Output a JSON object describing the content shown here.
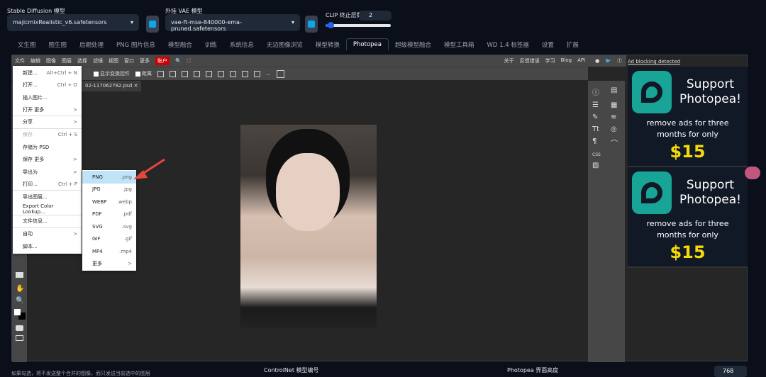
{
  "header": {
    "sd_label": "Stable Diffusion 模型",
    "sd_value": "majicmixRealistic_v6.safetensors",
    "vae_label": "外挂 VAE 模型",
    "vae_value": "vae-ft-mse-840000-ema-pruned.safetensors",
    "clip_label": "CLIP 终止层数",
    "clip_value": "2",
    "clip_fraction": 0.08
  },
  "tabs": [
    "文生图",
    "图生图",
    "后期处理",
    "PNG 图片信息",
    "模型融合",
    "训练",
    "系统信息",
    "无边图像浏览",
    "模型转换",
    "Photopea",
    "超级模型融合",
    "模型工具箱",
    "WD 1.4 标签器",
    "设置",
    "扩展"
  ],
  "photopea": {
    "menu": [
      "文件",
      "编辑",
      "图像",
      "图层",
      "选择",
      "滤镜",
      "视图",
      "窗口",
      "更多"
    ],
    "account": "账户",
    "right_links": [
      "关于",
      "反馈错误",
      "学习",
      "Blog",
      "API"
    ],
    "toolbar": {
      "show_transform": "显示变换控件",
      "distance": "距离",
      "more": "..."
    },
    "doc_tab": "02-117062782.psd",
    "file_menu": [
      {
        "label": "新建...",
        "key": "Alt+Ctrl + N"
      },
      {
        "label": "打开...",
        "key": "Ctrl + O"
      },
      {
        "label": "插入图片...",
        "key": ""
      },
      {
        "label": "打开 更多",
        "key": ">",
        "sep": true
      },
      {
        "label": "分享",
        "key": ">",
        "sep": true
      },
      {
        "label": "保存",
        "key": "Ctrl + S",
        "disabled": true
      },
      {
        "label": "存储为 PSD",
        "key": ""
      },
      {
        "label": "保存 更多",
        "key": ">"
      },
      {
        "label": "导出为",
        "key": ">"
      },
      {
        "label": "打印...",
        "key": "Ctrl + P",
        "sep": true
      },
      {
        "label": "导出图层...",
        "key": ""
      },
      {
        "label": "Export Color Lookup...",
        "key": "",
        "sep": true
      },
      {
        "label": "文件信息...",
        "key": "",
        "sep": true
      },
      {
        "label": "自动",
        "key": ">"
      },
      {
        "label": "脚本...",
        "key": ""
      }
    ],
    "export_menu": [
      {
        "label": "PNG",
        "ext": ".png"
      },
      {
        "label": "JPG",
        "ext": ".jpg"
      },
      {
        "label": "WEBP",
        "ext": ".webp"
      },
      {
        "label": "PDF",
        "ext": ".pdf"
      },
      {
        "label": "SVG",
        "ext": ".svg"
      },
      {
        "label": "GIF",
        "ext": ".gif"
      },
      {
        "label": "MP4",
        "ext": ".mp4"
      },
      {
        "label": "更多",
        "ext": ">"
      }
    ],
    "panel_css": "CSS",
    "ad_notice": "Ad blocking detected",
    "ads": [
      {
        "title": "Support Photopea!",
        "text": "remove ads for three months for only",
        "price": "$15"
      },
      {
        "title": "Support Photopea!",
        "text": "remove ads for three months for only",
        "price": "$15"
      }
    ]
  },
  "footer": {
    "note": "如果勾选，将不发送整个合并的图像，而只发送当前选中的图层",
    "controlnet_label": "ControlNet 模型编号",
    "height_label": "Photopea 界面高度",
    "height_value": "768"
  },
  "colors": {
    "accent": "#0ea5e9",
    "photopea_green": "#18a497",
    "price": "#f5d90a",
    "account": "#cc0000"
  }
}
